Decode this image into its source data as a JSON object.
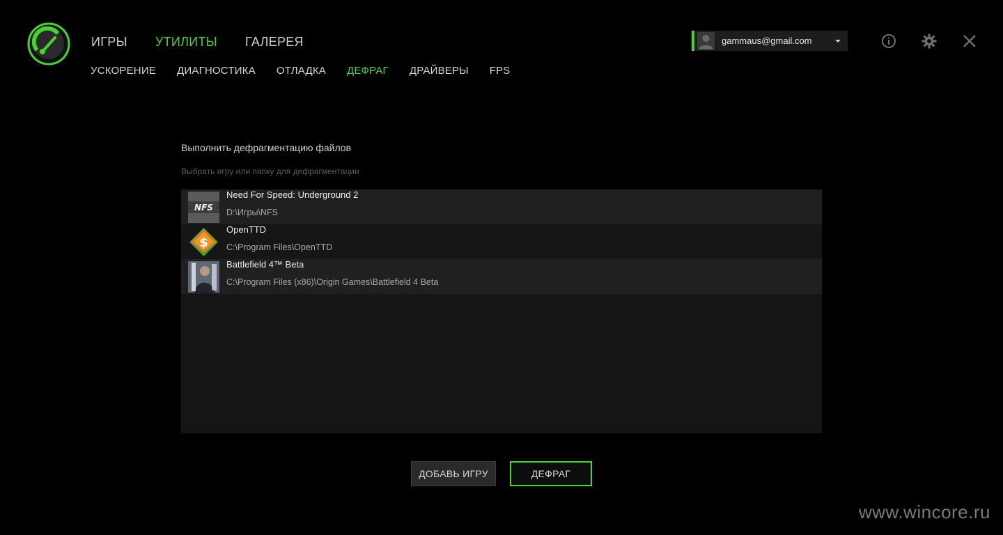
{
  "main_nav": [
    {
      "label": "ИГРЫ",
      "active": false
    },
    {
      "label": "УТИЛИТЫ",
      "active": true
    },
    {
      "label": "ГАЛЕРЕЯ",
      "active": false
    }
  ],
  "sub_nav": [
    {
      "label": "УСКОРЕНИЕ",
      "active": false
    },
    {
      "label": "ДИАГНОСТИКА",
      "active": false
    },
    {
      "label": "ОТЛАДКА",
      "active": false
    },
    {
      "label": "ДЕФРАГ",
      "active": true
    },
    {
      "label": "ДРАЙВЕРЫ",
      "active": false
    },
    {
      "label": "FPS",
      "active": false
    }
  ],
  "account": {
    "email": "gammaus@gmail.com"
  },
  "icons": {
    "logo": "speedometer-logo-icon",
    "info": "info-icon",
    "settings": "gear-icon",
    "close": "close-icon",
    "dropdown": "chevron-down-icon"
  },
  "content": {
    "title": "Выполнить дефрагментацию файлов",
    "hint": "Выбрать игру или папку для дефрагментации"
  },
  "games": [
    {
      "name": "Need For Speed: Underground 2",
      "path": "D:\\Игры\\NFS",
      "thumb_text": "NFS"
    },
    {
      "name": "OpenTTD",
      "path": "C:\\Program Files\\OpenTTD",
      "thumb_text": "$"
    },
    {
      "name": "Battlefield 4™ Beta",
      "path": "C:\\Program Files (x86)\\Origin Games\\Battlefield 4 Beta",
      "thumb_text": ""
    }
  ],
  "buttons": {
    "add_game": "ДОБАВЬ ИГРУ",
    "defrag": "ДЕФРАГ"
  },
  "watermark": "www.wincore.ru",
  "colors": {
    "accent": "#44d62c",
    "background": "#000000"
  }
}
